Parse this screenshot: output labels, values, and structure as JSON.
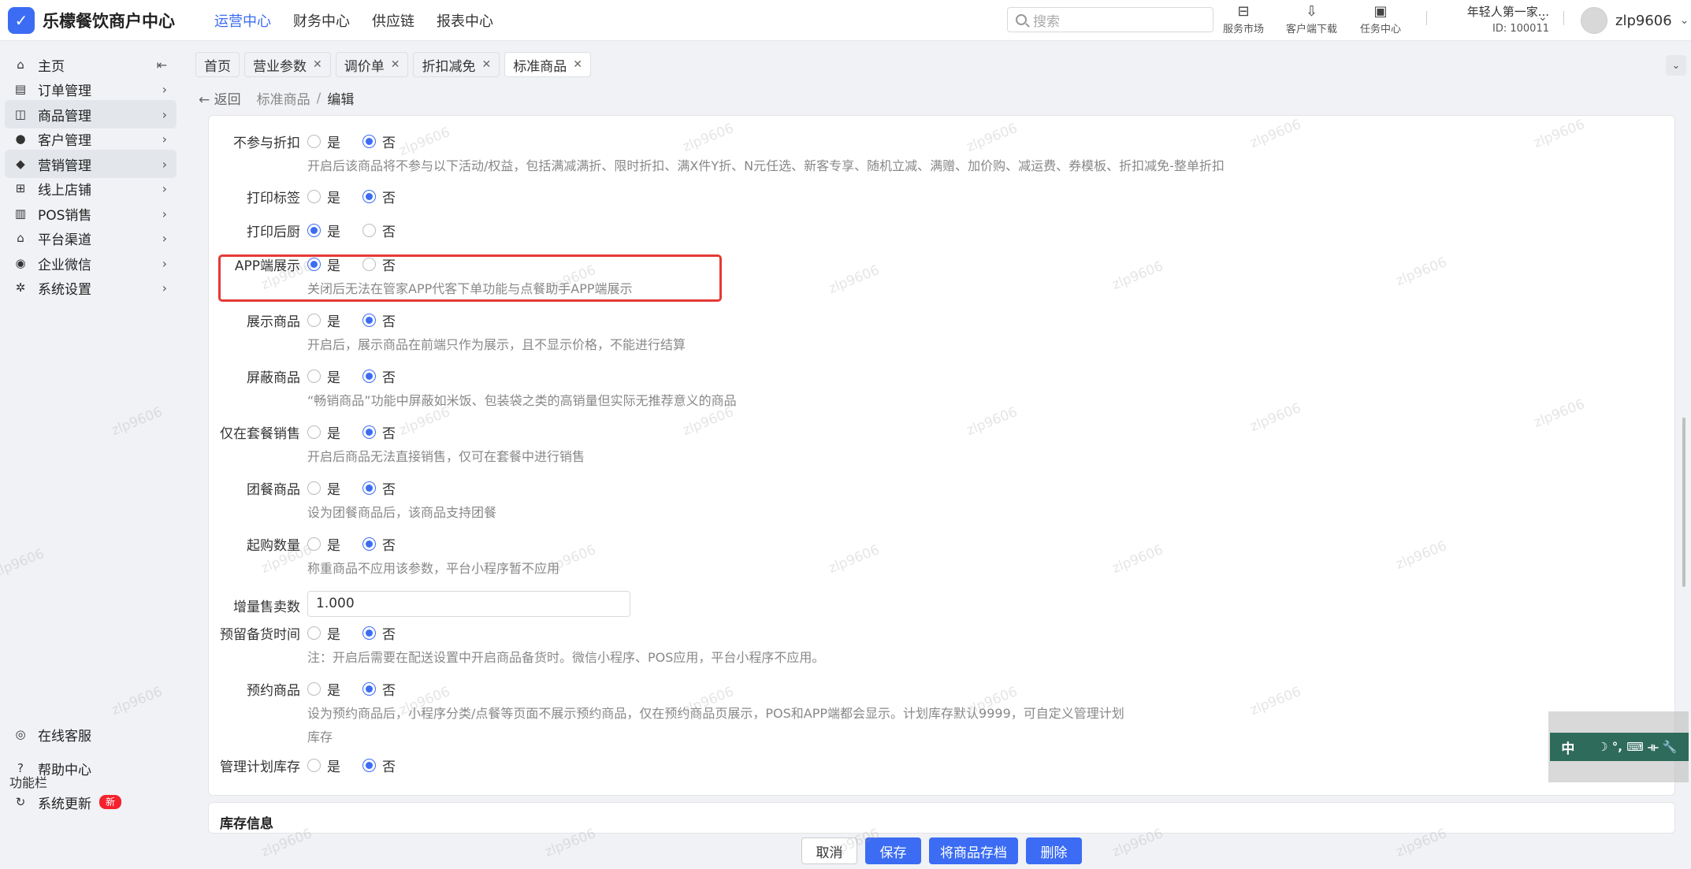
{
  "app": {
    "title": "乐檬餐饮商户中心",
    "logo_char": "✓"
  },
  "topnav": [
    {
      "label": "运营中心",
      "active": true
    },
    {
      "label": "财务中心"
    },
    {
      "label": "供应链"
    },
    {
      "label": "报表中心"
    }
  ],
  "search": {
    "placeholder": "搜索"
  },
  "top_icons": [
    {
      "label": "服务市场",
      "icon": "briefcase-icon"
    },
    {
      "label": "客户端下载",
      "icon": "download-icon"
    },
    {
      "label": "任务中心",
      "icon": "clipboard-icon"
    }
  ],
  "shop": {
    "name": "年轻人第一家...",
    "id": "ID: 100011"
  },
  "user": {
    "name": "zlp9606"
  },
  "sidebar": {
    "items": [
      {
        "label": "主页",
        "icon": "home-icon",
        "glyph": "⌂",
        "arrow": "⇤"
      },
      {
        "label": "订单管理",
        "icon": "order-icon",
        "glyph": "▤",
        "arrow": "›"
      },
      {
        "label": "商品管理",
        "icon": "goods-icon",
        "glyph": "◫",
        "arrow": "›",
        "active": true
      },
      {
        "label": "客户管理",
        "icon": "user-icon",
        "glyph": "●",
        "arrow": "›"
      },
      {
        "label": "营销管理",
        "icon": "tag-icon",
        "glyph": "◆",
        "arrow": "›",
        "active": true
      },
      {
        "label": "线上店铺",
        "icon": "shop-icon",
        "glyph": "⊞",
        "arrow": "›"
      },
      {
        "label": "POS销售",
        "icon": "pos-icon",
        "glyph": "▥",
        "arrow": "›"
      },
      {
        "label": "平台渠道",
        "icon": "bank-icon",
        "glyph": "⌂",
        "arrow": "›"
      },
      {
        "label": "企业微信",
        "icon": "wechat-icon",
        "glyph": "◉",
        "arrow": "›"
      },
      {
        "label": "系统设置",
        "icon": "gear-icon",
        "glyph": "✲",
        "arrow": "›"
      }
    ],
    "section_title": "功能栏",
    "bottom": [
      {
        "label": "在线客服",
        "icon": "service-icon",
        "glyph": "◎"
      },
      {
        "label": "帮助中心",
        "icon": "help-icon",
        "glyph": "?"
      },
      {
        "label": "系统更新",
        "icon": "refresh-icon",
        "glyph": "↻",
        "badge": "新"
      }
    ]
  },
  "tabs": [
    {
      "label": "首页",
      "closable": false
    },
    {
      "label": "营业参数",
      "closable": true
    },
    {
      "label": "调价单",
      "closable": true
    },
    {
      "label": "折扣减免",
      "closable": true
    },
    {
      "label": "标准商品",
      "closable": true,
      "active": true
    }
  ],
  "breadcrumb": {
    "back": "返回",
    "parent": "标准商品",
    "sep": "/",
    "current": "编辑"
  },
  "form": {
    "yes": "是",
    "no": "否",
    "rows": [
      {
        "label": "不参与折扣",
        "value": "no",
        "hint": "开启后该商品将不参与以下活动/权益，包括满减满折、限时折扣、满X件Y折、N元任选、新客专享、随机立减、满赠、加价购、减运费、券模板、折扣减免-整单折扣"
      },
      {
        "label": "打印标签",
        "value": "no"
      },
      {
        "label": "打印后厨",
        "value": "yes"
      },
      {
        "label": "APP端展示",
        "value": "yes",
        "hint": "关闭后无法在管家APP代客下单功能与点餐助手APP端展示",
        "highlight": true
      },
      {
        "label": "展示商品",
        "value": "no",
        "hint": "开启后，展示商品在前端只作为展示，且不显示价格，不能进行结算"
      },
      {
        "label": "屏蔽商品",
        "value": "no",
        "hint": "“畅销商品”功能中屏蔽如米饭、包装袋之类的高销量但实际无推荐意义的商品"
      },
      {
        "label": "仅在套餐销售",
        "value": "no",
        "hint": "开启后商品无法直接销售，仅可在套餐中进行销售"
      },
      {
        "label": "团餐商品",
        "value": "no",
        "hint": "设为团餐商品后，该商品支持团餐"
      },
      {
        "label": "起购数量",
        "value": "no",
        "hint": "称重商品不应用该参数，平台小程序暂不应用"
      },
      {
        "label": "增量售卖数",
        "input": "1.000"
      },
      {
        "label": "预留备货时间",
        "value": "no",
        "hint": "注：开启后需要在配送设置中开启商品备货时。微信小程序、POS应用，平台小程序不应用。"
      },
      {
        "label": "预约商品",
        "value": "no",
        "hint": "设为预约商品后，小程序分类/点餐等页面不展示预约商品，仅在预约商品页展示，POS和APP端都会显示。计划库存默认9999，可自定义管理计划",
        "hint2": "库存"
      },
      {
        "label": "管理计划库存",
        "value": "no"
      }
    ]
  },
  "section2_title": "库存信息",
  "footer": {
    "cancel": "取消",
    "save": "保存",
    "archive": "将商品存档",
    "delete": "删除"
  },
  "ime": {
    "label": "中",
    "icons": "☽ °, ⌨ ⟛ 🔧"
  },
  "watermark": "zlp9606",
  "colors": {
    "primary": "#3b6cf3",
    "highlight": "#e53935"
  }
}
